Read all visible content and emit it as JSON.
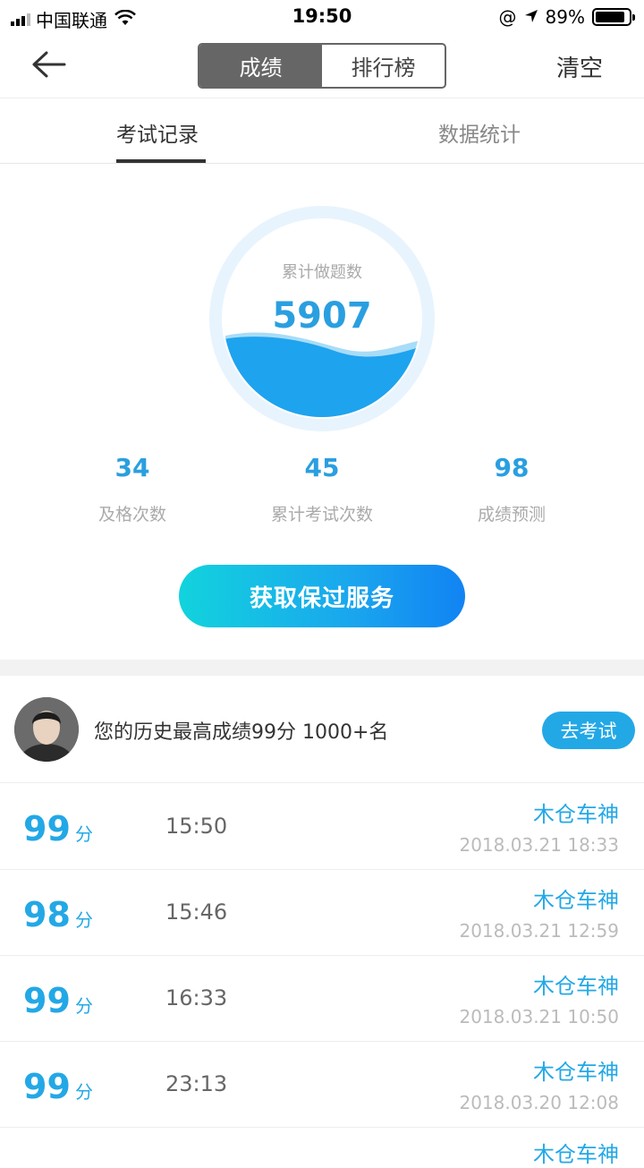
{
  "status_bar": {
    "carrier": "中国联通",
    "time": "19:50",
    "battery": "89%",
    "battery_level": 0.89
  },
  "nav": {
    "segments": [
      "成绩",
      "排行榜"
    ],
    "active_segment": 0,
    "clear_label": "清空"
  },
  "tabs": {
    "items": [
      "考试记录",
      "数据统计"
    ],
    "active": 0
  },
  "summary": {
    "circle_label": "累计做题数",
    "circle_value": "5907",
    "stats": [
      {
        "value": "34",
        "label": "及格次数"
      },
      {
        "value": "45",
        "label": "累计考试次数"
      },
      {
        "value": "98",
        "label": "成绩预测"
      }
    ],
    "cta_label": "获取保过服务"
  },
  "best": {
    "text": "您的历史最高成绩99分 1000+名",
    "button_label": "去考试"
  },
  "records": [
    {
      "score": "99",
      "unit": "分",
      "duration": "15:50",
      "name": "木仓车神",
      "date": "2018.03.21 18:33"
    },
    {
      "score": "98",
      "unit": "分",
      "duration": "15:46",
      "name": "木仓车神",
      "date": "2018.03.21 12:59"
    },
    {
      "score": "99",
      "unit": "分",
      "duration": "16:33",
      "name": "木仓车神",
      "date": "2018.03.21 10:50"
    },
    {
      "score": "99",
      "unit": "分",
      "duration": "23:13",
      "name": "木仓车神",
      "date": "2018.03.20 12:08"
    }
  ],
  "partial_record": {
    "name": "木仓车神"
  },
  "colors": {
    "accent": "#23a8e6",
    "nav_active": "#666666"
  }
}
